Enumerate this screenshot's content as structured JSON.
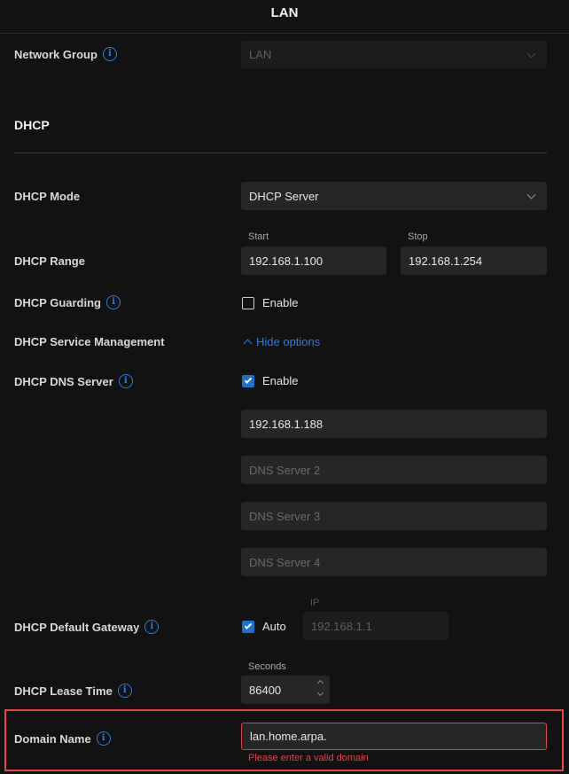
{
  "header": {
    "title": "LAN"
  },
  "network_group": {
    "label": "Network Group",
    "value": "LAN"
  },
  "dhcp_section": {
    "title": "DHCP"
  },
  "dhcp_mode": {
    "label": "DHCP Mode",
    "value": "DHCP Server"
  },
  "dhcp_range": {
    "label": "DHCP Range",
    "start_label": "Start",
    "start_value": "192.168.1.100",
    "stop_label": "Stop",
    "stop_value": "192.168.1.254"
  },
  "dhcp_guarding": {
    "label": "DHCP Guarding",
    "checkbox_label": "Enable",
    "checked": false
  },
  "service_mgmt": {
    "label": "DHCP Service Management",
    "link": "Hide options"
  },
  "dns_server": {
    "label": "DHCP DNS Server",
    "checkbox_label": "Enable",
    "checked": true,
    "server1_value": "192.168.1.188",
    "server2_placeholder": "DNS Server 2",
    "server3_placeholder": "DNS Server 3",
    "server4_placeholder": "DNS Server 4"
  },
  "default_gateway": {
    "label": "DHCP Default Gateway",
    "checkbox_label": "Auto",
    "checked": true,
    "ip_label": "IP",
    "ip_placeholder": "192.168.1.1"
  },
  "lease_time": {
    "label": "DHCP Lease Time",
    "unit_label": "Seconds",
    "value": "86400"
  },
  "domain_name": {
    "label": "Domain Name",
    "value": "lan.home.arpa.",
    "error": "Please enter a valid domain"
  },
  "colors": {
    "accent": "#2a7de1",
    "error": "#e0444c",
    "highlight": "#e64848",
    "background": "#121212"
  }
}
